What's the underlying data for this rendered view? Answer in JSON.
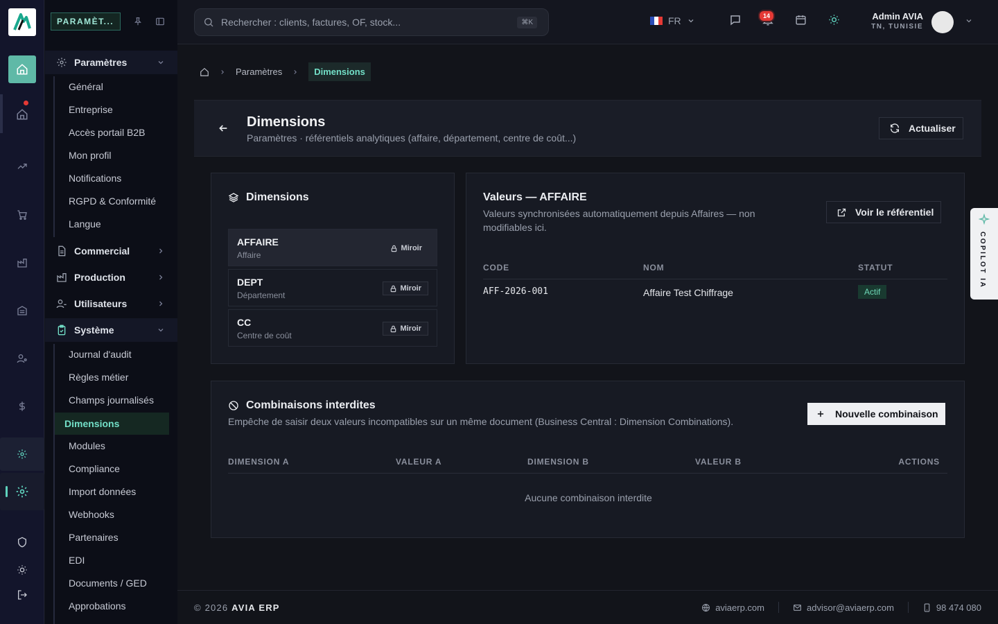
{
  "colors": {
    "accent": "#5fb9a7",
    "accent_text": "#73e0c8",
    "danger": "#e53935",
    "bg": "#12141a"
  },
  "sidebar": {
    "header_label": "PARAMÈT...",
    "groups": [
      {
        "label": "Paramètres",
        "icon": "settings-icon",
        "expanded": true,
        "items": [
          "Général",
          "Entreprise",
          "Accès portail B2B",
          "Mon profil",
          "Notifications",
          "RGPD & Conformité",
          "Langue"
        ]
      },
      {
        "label": "Commercial",
        "icon": "document-icon",
        "expanded": false
      },
      {
        "label": "Production",
        "icon": "factory-icon",
        "expanded": false
      },
      {
        "label": "Utilisateurs",
        "icon": "users-icon",
        "expanded": false
      },
      {
        "label": "Système",
        "icon": "clipboard-icon",
        "expanded": true,
        "items": [
          "Journal d'audit",
          "Règles métier",
          "Champs journalisés",
          "Dimensions",
          "Modules",
          "Compliance",
          "Import données",
          "Webhooks",
          "Partenaires",
          "EDI",
          "Documents / GED",
          "Approbations"
        ]
      }
    ],
    "active_item": "Dimensions"
  },
  "topbar": {
    "search_placeholder": "Rechercher : clients, factures, OF, stock...",
    "search_shortcut": "⌘K",
    "language": "FR",
    "notifications_count": "14",
    "user_name": "Admin AVIA",
    "user_location": "TN, TUNISIE"
  },
  "breadcrumb": {
    "parent": "Paramètres",
    "current": "Dimensions"
  },
  "page": {
    "title": "Dimensions",
    "subtitle": "Paramètres · référentiels analytiques (affaire, département, centre de coût...)",
    "refresh_label": "Actualiser"
  },
  "dimensions_card": {
    "title": "Dimensions",
    "items": [
      {
        "code": "AFFAIRE",
        "label": "Affaire",
        "badge": "Miroir"
      },
      {
        "code": "DEPT",
        "label": "Département",
        "badge": "Miroir"
      },
      {
        "code": "CC",
        "label": "Centre de coût",
        "badge": "Miroir"
      }
    ]
  },
  "values_card": {
    "title": "Valeurs — AFFAIRE",
    "description": "Valeurs synchronisées automatiquement depuis Affaires — non modifiables ici.",
    "action_label": "Voir le référentiel",
    "columns": [
      "CODE",
      "NOM",
      "STATUT"
    ],
    "rows": [
      {
        "code": "AFF-2026-001",
        "nom": "Affaire Test Chiffrage",
        "statut": "Actif"
      }
    ]
  },
  "combinations_card": {
    "title": "Combinaisons interdites",
    "description": "Empêche de saisir deux valeurs incompatibles sur un même document (Business Central : Dimension Combinations).",
    "new_label": "Nouvelle combinaison",
    "columns": [
      "DIMENSION A",
      "VALEUR A",
      "DIMENSION B",
      "VALEUR B",
      "ACTIONS"
    ],
    "empty_text": "Aucune combinaison interdite"
  },
  "copilot": {
    "label": "COPILOT IA"
  },
  "footer": {
    "copyright": "© 2026",
    "brand": "AVIA ERP",
    "website": "aviaerp.com",
    "email": "advisor@aviaerp.com",
    "phone": "98 474 080"
  }
}
